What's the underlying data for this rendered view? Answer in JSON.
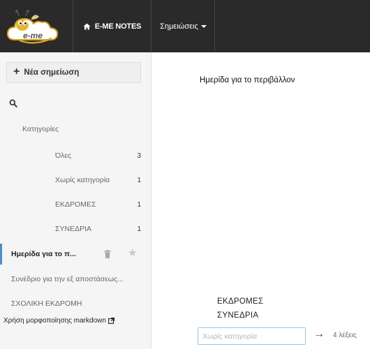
{
  "app": {
    "brand_label": "E-ME NOTES",
    "logo_text": "e-me",
    "menu_label": "Σημειώσεις"
  },
  "sidebar": {
    "new_note_label": "Νέα σημείωση",
    "categories_heading": "Κατηγορίες",
    "categories": [
      {
        "label": "Όλες",
        "count": "3"
      },
      {
        "label": "Χωρίς κατηγορία",
        "count": "1"
      },
      {
        "label": "ΕΚΔΡΟΜΕΣ",
        "count": "1"
      },
      {
        "label": "ΣΥΝΕΔΡΙΑ",
        "count": "1"
      }
    ],
    "notes": [
      {
        "title": "Ημερίδα για το π..."
      },
      {
        "title": "Συνέδριο για την εξ αποστάσεως..."
      },
      {
        "title": "ΣΧΟΛΙΚΗ ΕΚΔΡΟΜΗ"
      }
    ],
    "markdown_link": "Χρήση μορφοποίησης markdown"
  },
  "editor": {
    "note_title": "Ημερίδα για το περιβάλλον",
    "category_options": [
      "ΕΚΔΡΟΜΕΣ",
      "ΣΥΝΕΔΡΙΑ"
    ],
    "category_placeholder": "Χωρίς κατηγορία",
    "word_count": "4 λέξεις"
  },
  "colors": {
    "topbar": "#2a2a2a",
    "sidebar": "#f5f5f5",
    "active_accent": "#4a90c8"
  }
}
